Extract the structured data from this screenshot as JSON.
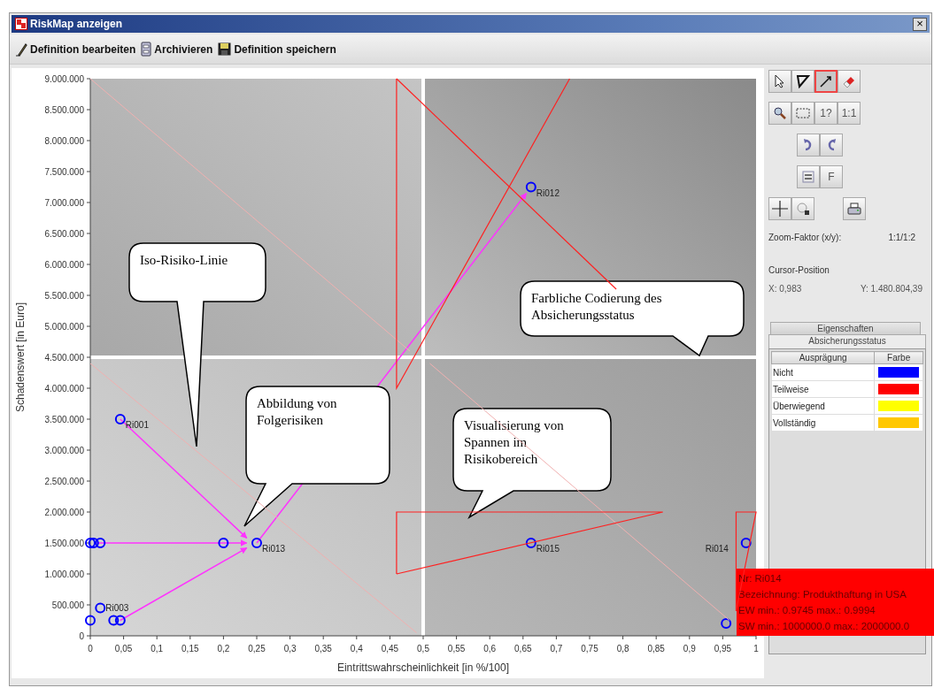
{
  "window": {
    "title": "RiskMap anzeigen",
    "close": "×"
  },
  "toolbar": [
    {
      "label": "Definition bearbeiten",
      "kind": "pencil"
    },
    {
      "label": "Archivieren",
      "kind": "cabinet"
    },
    {
      "label": "Definition speichern",
      "kind": "disk"
    }
  ],
  "chart_data": {
    "type": "scatter",
    "xlabel": "Eintrittswahrscheinlichkeit [in %/100]",
    "ylabel": "Schadenswert [in Euro]",
    "xlim": [
      0,
      1
    ],
    "ylim": [
      0,
      9000000
    ],
    "xticks": [
      {
        "value": 0,
        "label": "0"
      },
      {
        "value": 0.05,
        "label": "0,05"
      },
      {
        "value": 0.1,
        "label": "0,1"
      },
      {
        "value": 0.15,
        "label": "0,15"
      },
      {
        "value": 0.2,
        "label": "0,2"
      },
      {
        "value": 0.25,
        "label": "0,25"
      },
      {
        "value": 0.3,
        "label": "0,3"
      },
      {
        "value": 0.35,
        "label": "0,35"
      },
      {
        "value": 0.4,
        "label": "0,4"
      },
      {
        "value": 0.45,
        "label": "0,45"
      },
      {
        "value": 0.5,
        "label": "0,5"
      },
      {
        "value": 0.55,
        "label": "0,55"
      },
      {
        "value": 0.6,
        "label": "0,6"
      },
      {
        "value": 0.65,
        "label": "0,65"
      },
      {
        "value": 0.7,
        "label": "0,7"
      },
      {
        "value": 0.75,
        "label": "0,75"
      },
      {
        "value": 0.8,
        "label": "0,8"
      },
      {
        "value": 0.85,
        "label": "0,85"
      },
      {
        "value": 0.9,
        "label": "0,9"
      },
      {
        "value": 0.95,
        "label": "0,95"
      },
      {
        "value": 1,
        "label": "1"
      }
    ],
    "yticks": [
      {
        "value": 0,
        "label": "0"
      },
      {
        "value": 500000,
        "label": "500.000"
      },
      {
        "value": 1000000,
        "label": "1.000.000"
      },
      {
        "value": 1500000,
        "label": "1.500.000"
      },
      {
        "value": 2000000,
        "label": "2.000.000"
      },
      {
        "value": 2500000,
        "label": "2.500.000"
      },
      {
        "value": 3000000,
        "label": "3.000.000"
      },
      {
        "value": 3500000,
        "label": "3.500.000"
      },
      {
        "value": 4000000,
        "label": "4.000.000"
      },
      {
        "value": 4500000,
        "label": "4.500.000"
      },
      {
        "value": 5000000,
        "label": "5.000.000"
      },
      {
        "value": 5500000,
        "label": "5.500.000"
      },
      {
        "value": 6000000,
        "label": "6.000.000"
      },
      {
        "value": 6500000,
        "label": "6.500.000"
      },
      {
        "value": 7000000,
        "label": "7.000.000"
      },
      {
        "value": 7500000,
        "label": "7.500.000"
      },
      {
        "value": 8000000,
        "label": "8.000.000"
      },
      {
        "value": 8500000,
        "label": "8.500.000"
      },
      {
        "value": 9000000,
        "label": "9.000.000"
      }
    ],
    "x": [
      0,
      0.005,
      0.015,
      0.2,
      0.25,
      0.015,
      0,
      0.035,
      0.045,
      0.045,
      0.662,
      0.662,
      0.985,
      0.955
    ],
    "series": [
      {
        "color": "#0000ff",
        "values": [
          1500000,
          1500000,
          1500000,
          1500000,
          1500000,
          450000,
          250000,
          250000,
          250000,
          3500000,
          7250000,
          1500000,
          1500000,
          200000
        ]
      }
    ],
    "annotations": [
      {
        "text": "Ri001",
        "x": 0.045,
        "y": 3500000
      },
      {
        "text": "Ri012",
        "x": 0.662,
        "y": 7250000
      },
      {
        "text": "Ri013",
        "x": 0.25,
        "y": 1500000
      },
      {
        "text": "Ri015",
        "x": 0.662,
        "y": 1500000
      },
      {
        "text": "Ri014",
        "x": 0.985,
        "y": 1500000
      },
      {
        "text": "Ri003",
        "x": 0.015,
        "y": 450000
      }
    ]
  },
  "callouts": [
    {
      "text": "Iso-Risiko-Linie"
    },
    {
      "text": "Farbliche Codierung des Absicherungsstatus"
    },
    {
      "text": "Abbildung von Folgerisiken"
    },
    {
      "text": "Visualisierung von Spannen im Risikobereich"
    }
  ],
  "tooltip": [
    "Nr: Ri014",
    "Bezeichnung: Produkthaftung in USA",
    "EW min.: 0.9745 max.: 0.9994",
    "SW min.: 1000000.0 max.: 2000000.0"
  ],
  "tools": [
    {
      "kind": "pointer",
      "selected": false
    },
    {
      "kind": "triangle",
      "selected": false
    },
    {
      "kind": "line",
      "selected": true
    },
    {
      "kind": "eraser",
      "selected": false
    },
    {
      "kind": "magnifier",
      "selected": false
    },
    {
      "kind": "marquee",
      "selected": false
    },
    {
      "kind": "text",
      "label": "1?",
      "selected": false
    },
    {
      "kind": "text",
      "label": "1:1",
      "selected": false
    },
    {
      "kind": "undo",
      "selected": false
    },
    {
      "kind": "redo",
      "selected": false
    },
    {
      "kind": "frame",
      "selected": false
    },
    {
      "kind": "text",
      "label": "F",
      "selected": false
    },
    {
      "kind": "cross",
      "selected": false
    },
    {
      "kind": "lasso",
      "selected": false
    },
    {
      "kind": "printer",
      "selected": false
    }
  ],
  "zoom": {
    "label": "Zoom-Faktor (x/y):",
    "value": "1:1/1:2"
  },
  "cursor": {
    "label": "Cursor-Position",
    "x": "X: 0,983",
    "y": "Y: 1.480.804,39"
  },
  "tabs": [
    {
      "label": "Eigenschaften",
      "selected": false
    },
    {
      "label": "Absicherungsstatus",
      "selected": true
    }
  ],
  "table": {
    "columns": [
      "Ausprägung",
      "Farbe"
    ],
    "rows": [
      {
        "name": "Nicht",
        "color": "#0000ff"
      },
      {
        "name": "Teilweise",
        "color": "#ff0000"
      },
      {
        "name": "Überwiegend",
        "color": "#ffff00"
      },
      {
        "name": "Vollständig",
        "color": "#ffc800"
      }
    ]
  }
}
